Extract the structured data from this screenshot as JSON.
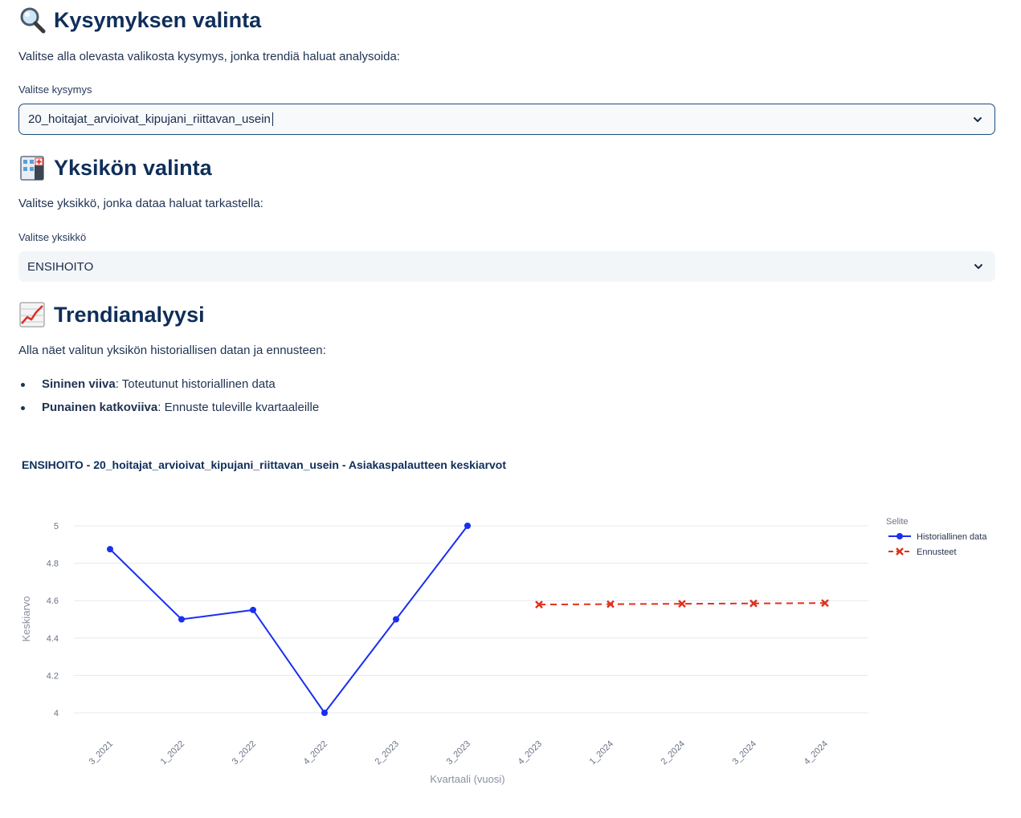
{
  "question_section": {
    "heading": "Kysymyksen valinta",
    "description": "Valitse alla olevasta valikosta kysymys, jonka trendiä haluat analysoida:",
    "select_label": "Valitse kysymys",
    "select_value": "20_hoitajat_arvioivat_kipujani_riittavan_usein"
  },
  "unit_section": {
    "heading": "Yksikön valinta",
    "description": "Valitse yksikkö, jonka dataa haluat tarkastella:",
    "select_label": "Valitse yksikkö",
    "select_value": "ENSIHOITO"
  },
  "trend_section": {
    "heading": "Trendianalyysi",
    "description": "Alla näet valitun yksikön historiallisen datan ja ennusteen:",
    "bullets": [
      {
        "bold": "Sininen viiva",
        "text": ": Toteutunut historiallinen data"
      },
      {
        "bold": "Punainen katkoviiva",
        "text": ": Ennuste tuleville kvartaaleille"
      }
    ]
  },
  "colors": {
    "heading": "#0f2e5a",
    "historical": "#1a2ff0",
    "forecast": "#e0321c"
  },
  "chart_data": {
    "type": "line",
    "title": "ENSIHOITO - 20_hoitajat_arvioivat_kipujani_riittavan_usein - Asiakaspalautteen keskiarvot",
    "xlabel": "Kvartaali (vuosi)",
    "ylabel": "Keskiarvo",
    "categories": [
      "3_2021",
      "1_2022",
      "3_2022",
      "4_2022",
      "2_2023",
      "3_2023",
      "4_2023",
      "1_2024",
      "2_2024",
      "3_2024",
      "4_2024"
    ],
    "ylim": [
      4,
      5
    ],
    "yticks": [
      "4",
      "4.2",
      "4.4",
      "4.6",
      "4.8",
      "5"
    ],
    "grid": true,
    "legend_title": "Selite",
    "legend_position": "right",
    "series": [
      {
        "name": "Historiallinen data",
        "x": [
          "3_2021",
          "1_2022",
          "3_2022",
          "4_2022",
          "2_2023",
          "3_2023"
        ],
        "values": [
          4.875,
          4.5,
          4.55,
          4.0,
          4.5,
          5.0
        ],
        "style": "solid-circle"
      },
      {
        "name": "Ennusteet",
        "x": [
          "4_2023",
          "1_2024",
          "2_2024",
          "3_2024",
          "4_2024"
        ],
        "values": [
          4.579,
          4.581,
          4.583,
          4.585,
          4.587
        ],
        "style": "dashed-x"
      }
    ]
  }
}
